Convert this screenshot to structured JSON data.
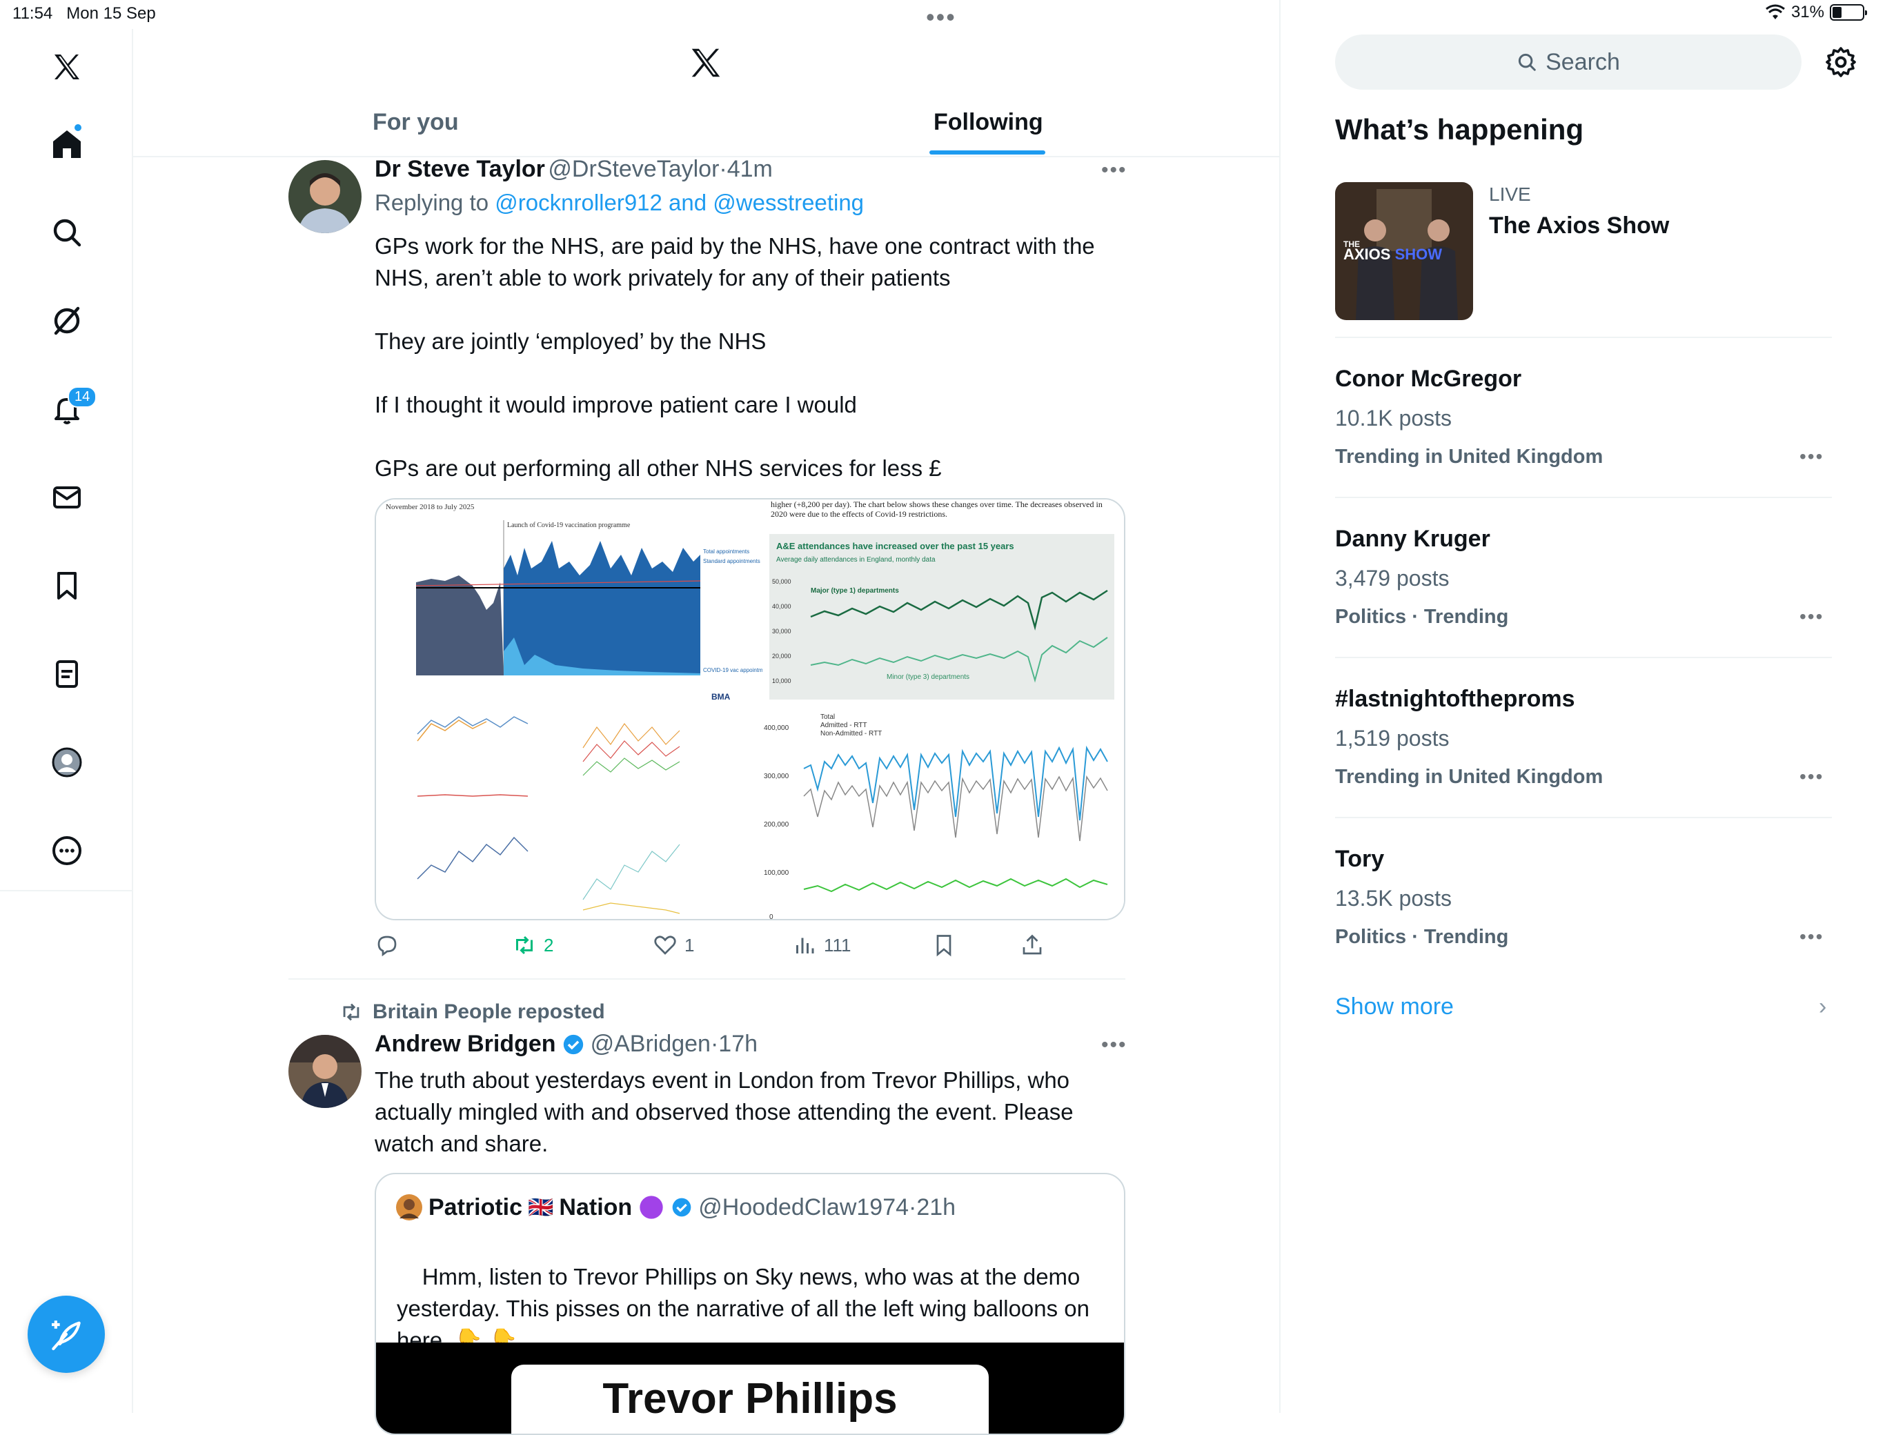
{
  "status_bar": {
    "time": "11:54",
    "date": "Mon 15 Sep",
    "battery": "31%",
    "battery_level": 0.31
  },
  "left_nav": {
    "items": [
      "x-logo",
      "home-icon",
      "search-icon",
      "grok-icon",
      "notifications-icon",
      "messages-icon",
      "bookmarks-icon",
      "lists-icon",
      "profile-icon",
      "more-icon"
    ],
    "notifications_badge": "14",
    "compose_icon": "compose-icon"
  },
  "tabs": {
    "for_you": "For you",
    "following": "Following",
    "active": "Following"
  },
  "tweet1": {
    "name": "Dr Steve Taylor",
    "handle": "@DrSteveTaylor",
    "sep": "·",
    "time": "41m",
    "replying_prefix": "Replying to",
    "replying_to": "@rocknroller912 and @wesstreeting",
    "text": "GPs work for the NHS, are paid by the NHS, have one contract with the NHS, aren’t able to work privately for any of their patients\n\nThey are jointly ‘employed’ by the NHS\n\nIf I thought it would improve patient care I would\n\nGPs are out performing all other NHS services for less £",
    "media": {
      "chart1_title": "November 2018 to July 2025",
      "chart1_annotation": "Launch of Covid-19 vaccination programme",
      "chart1_legend": [
        "Total appointments",
        "Standard appointments",
        "COVID-19 vac appointments"
      ],
      "chart1_source": "BMA",
      "chart2_header": "higher (+8,200 per day). The chart below shows these changes over time. The decreases observed in 2020 were due to the effects of Covid-19 restrictions.",
      "chart2_title": "A&E attendances have increased over the past 15 years",
      "chart2_subtitle": "Average daily attendances in England, monthly data",
      "chart2_yticks": [
        "50,000",
        "40,000",
        "30,000",
        "20,000",
        "10,000"
      ],
      "chart2_series": [
        "Major (type 1) departments",
        "Minor (type 3) departments"
      ],
      "chart3_legend": [
        "Total",
        "Admitted - RTT",
        "Non-Admitted - RTT"
      ],
      "chart3_yticks": [
        "400,000",
        "300,000",
        "200,000",
        "100,000",
        "0"
      ]
    },
    "actions": {
      "reply": "",
      "retweets": "2",
      "likes": "1",
      "views": "111"
    }
  },
  "tweet2": {
    "reposted_by": "Britain People reposted",
    "name": "Andrew Bridgen",
    "handle": "@ABridgen",
    "sep": "·",
    "time": "17h",
    "text": "The truth about yesterdays event in London from Trevor Phillips, who actually mingled with and observed those attending the event. Please watch and share.",
    "quote": {
      "name_part1": "Patriotic",
      "flag": "🇬🇧",
      "name_part2": "Nation",
      "handle": "@HoodedClaw1974",
      "sep": "·",
      "time": "21h",
      "text": "Hmm, listen to Trevor Phillips on Sky news, who was at the demo yesterday. This pisses on the narrative of all the left wing balloons on here.",
      "emoji": "👇 👇",
      "video_caption": "Trevor Phillips"
    }
  },
  "sidebar": {
    "search_placeholder": "Search",
    "title": "What’s happening",
    "live": {
      "label": "LIVE",
      "title": "The Axios Show",
      "thumb_text": "THE AXIOS SHOW"
    },
    "trends": [
      {
        "name": "Conor McGregor",
        "count": "10.1K posts",
        "context": "Trending in United Kingdom"
      },
      {
        "name": "Danny Kruger",
        "count": "3,479 posts",
        "context": "Politics · Trending"
      },
      {
        "name": "#lastnightoftheproms",
        "count": "1,519 posts",
        "context": "Trending in United Kingdom"
      },
      {
        "name": "Tory",
        "count": "13.5K posts",
        "context": "Politics · Trending"
      }
    ],
    "show_more": "Show more"
  },
  "colors": {
    "accent": "#1d9bf0",
    "retweet_green": "#00ba7c",
    "text": "#0f1419",
    "muted": "#536471"
  }
}
